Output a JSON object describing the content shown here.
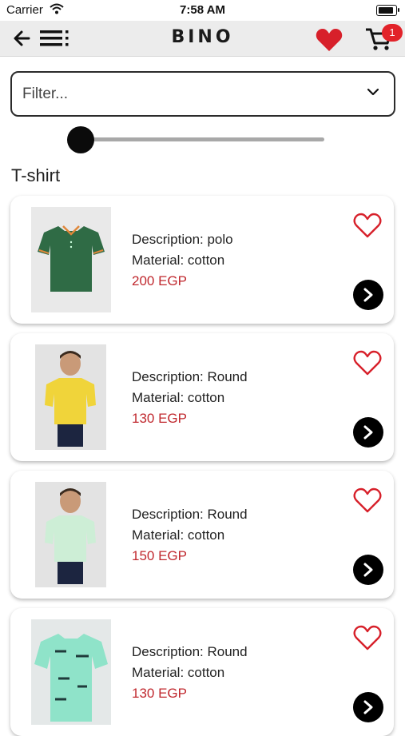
{
  "status_bar": {
    "carrier": "Carrier",
    "time": "7:58 AM",
    "battery_level": 0.9
  },
  "header": {
    "brand": "BINO",
    "cart_count": "1"
  },
  "filter": {
    "placeholder": "Filter..."
  },
  "price_slider": {
    "value": 0
  },
  "section": {
    "title": "T-shirt"
  },
  "products": [
    {
      "description": "Description: polo",
      "material": "Material: cotton",
      "price": "200 EGP",
      "shirt_color": "#2f6b45",
      "image_bg": "#e9e9e9"
    },
    {
      "description": "Description: Round",
      "material": "Material: cotton",
      "price": "130 EGP",
      "shirt_color": "#f0d43a",
      "image_bg": "#e3e3e3"
    },
    {
      "description": "Description: Round",
      "material": "Material: cotton",
      "price": "150 EGP",
      "shirt_color": "#cdeed6",
      "image_bg": "#e3e3e3"
    },
    {
      "description": "Description: Round",
      "material": "Material: cotton",
      "price": "130 EGP",
      "shirt_color": "#8fe3c9",
      "image_bg": "#e4e8e8"
    }
  ],
  "colors": {
    "accent": "#e2232a",
    "price": "#c0282e"
  }
}
